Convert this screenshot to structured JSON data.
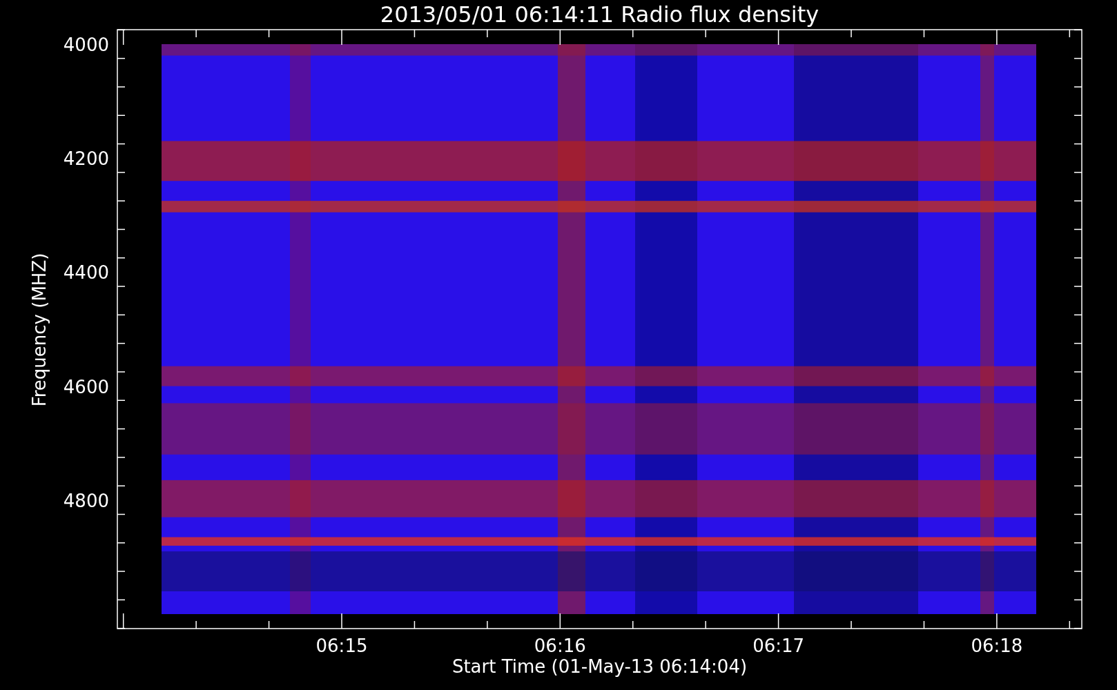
{
  "title": "2013/05/01 06:14:11 Radio flux density",
  "y_axis": {
    "label": "Frequency (MHZ)",
    "ticks": [
      "4000",
      "4200",
      "4400",
      "4600",
      "4800"
    ]
  },
  "x_axis": {
    "label": "Start Time (01-May-13 06:14:04)",
    "ticks": [
      "06:15",
      "06:16",
      "06:17",
      "06:18"
    ]
  }
}
